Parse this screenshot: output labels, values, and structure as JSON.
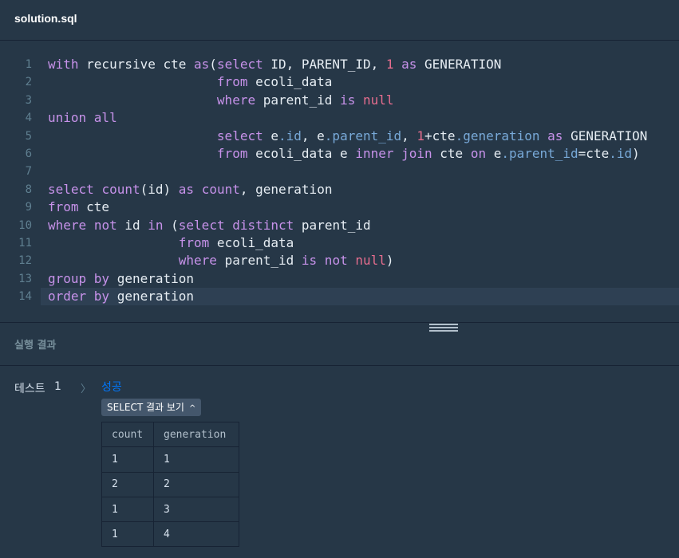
{
  "file": {
    "title": "solution.sql"
  },
  "editor": {
    "active_line": 14,
    "lines": [
      {
        "n": "1",
        "tokens": [
          [
            "kw",
            "with"
          ],
          [
            "p",
            " recursive cte "
          ],
          [
            "kw",
            "as"
          ],
          [
            "p",
            "("
          ],
          [
            "kw",
            "select"
          ],
          [
            "p",
            " ID, PARENT_ID, "
          ],
          [
            "num",
            "1"
          ],
          [
            "p",
            " "
          ],
          [
            "kw",
            "as"
          ],
          [
            "p",
            " GENERATION"
          ]
        ]
      },
      {
        "n": "2",
        "tokens": [
          [
            "p",
            "                      "
          ],
          [
            "kw",
            "from"
          ],
          [
            "p",
            " ecoli_data"
          ]
        ]
      },
      {
        "n": "3",
        "tokens": [
          [
            "p",
            "                      "
          ],
          [
            "kw",
            "where"
          ],
          [
            "p",
            " parent_id "
          ],
          [
            "kw",
            "is"
          ],
          [
            "p",
            " "
          ],
          [
            "nul",
            "null"
          ]
        ]
      },
      {
        "n": "4",
        "tokens": [
          [
            "kw",
            "union all"
          ]
        ]
      },
      {
        "n": "5",
        "tokens": [
          [
            "p",
            "                      "
          ],
          [
            "kw",
            "select"
          ],
          [
            "p",
            " e"
          ],
          [
            "prop",
            ".id"
          ],
          [
            "p",
            ", e"
          ],
          [
            "prop",
            ".parent_id"
          ],
          [
            "p",
            ", "
          ],
          [
            "num",
            "1"
          ],
          [
            "p",
            "+cte"
          ],
          [
            "prop",
            ".generation"
          ],
          [
            "p",
            " "
          ],
          [
            "kw",
            "as"
          ],
          [
            "p",
            " GENERATION"
          ]
        ]
      },
      {
        "n": "6",
        "tokens": [
          [
            "p",
            "                      "
          ],
          [
            "kw",
            "from"
          ],
          [
            "p",
            " ecoli_data e "
          ],
          [
            "kw",
            "inner join"
          ],
          [
            "p",
            " cte "
          ],
          [
            "kw",
            "on"
          ],
          [
            "p",
            " e"
          ],
          [
            "prop",
            ".parent_id"
          ],
          [
            "p",
            "=cte"
          ],
          [
            "prop",
            ".id"
          ],
          [
            "p",
            ")"
          ]
        ]
      },
      {
        "n": "7",
        "tokens": []
      },
      {
        "n": "8",
        "tokens": [
          [
            "kw",
            "select"
          ],
          [
            "p",
            " "
          ],
          [
            "kw",
            "count"
          ],
          [
            "p",
            "(id) "
          ],
          [
            "kw",
            "as"
          ],
          [
            "p",
            " "
          ],
          [
            "kw",
            "count"
          ],
          [
            "p",
            ", generation"
          ]
        ]
      },
      {
        "n": "9",
        "tokens": [
          [
            "kw",
            "from"
          ],
          [
            "p",
            " cte"
          ]
        ]
      },
      {
        "n": "10",
        "tokens": [
          [
            "kw",
            "where"
          ],
          [
            "p",
            " "
          ],
          [
            "kw",
            "not"
          ],
          [
            "p",
            " id "
          ],
          [
            "kw",
            "in"
          ],
          [
            "p",
            " ("
          ],
          [
            "kw",
            "select distinct"
          ],
          [
            "p",
            " parent_id"
          ]
        ]
      },
      {
        "n": "11",
        "tokens": [
          [
            "p",
            "                 "
          ],
          [
            "kw",
            "from"
          ],
          [
            "p",
            " ecoli_data"
          ]
        ]
      },
      {
        "n": "12",
        "tokens": [
          [
            "p",
            "                 "
          ],
          [
            "kw",
            "where"
          ],
          [
            "p",
            " parent_id "
          ],
          [
            "kw",
            "is not"
          ],
          [
            "p",
            " "
          ],
          [
            "nul",
            "null"
          ],
          [
            "p",
            ")"
          ]
        ]
      },
      {
        "n": "13",
        "tokens": [
          [
            "kw",
            "group by"
          ],
          [
            "p",
            " generation"
          ]
        ]
      },
      {
        "n": "14",
        "tokens": [
          [
            "kw",
            "order by"
          ],
          [
            "p",
            " generation"
          ]
        ]
      }
    ]
  },
  "result": {
    "title": "실행 결과",
    "test_label": "테스트",
    "test_number": "1",
    "chevron": "〉",
    "status": "성공",
    "select_button": "SELECT 결과 보기",
    "caret": "^",
    "table": {
      "headers": [
        "count",
        "generation"
      ],
      "rows": [
        [
          "1",
          "1"
        ],
        [
          "2",
          "2"
        ],
        [
          "1",
          "3"
        ],
        [
          "1",
          "4"
        ]
      ]
    }
  },
  "colors": {
    "background": "#263747",
    "keyword": "#c792ea",
    "number": "#e56d8e",
    "property": "#78a9d8",
    "success": "#0078ff"
  }
}
